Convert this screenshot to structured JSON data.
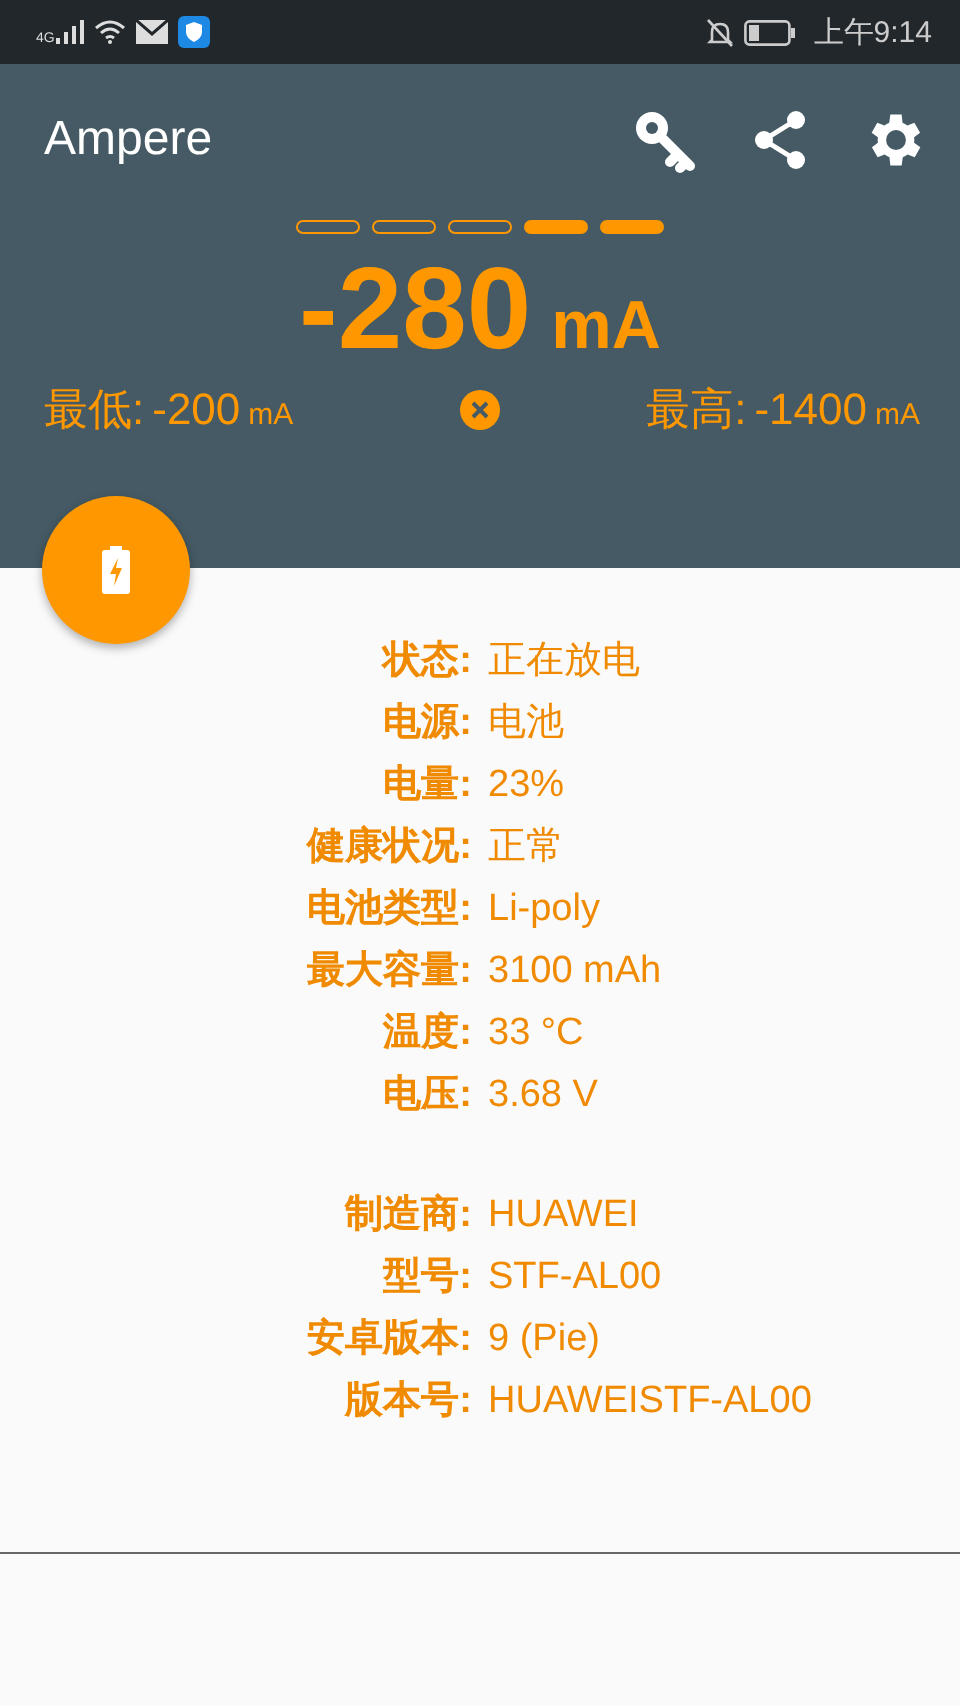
{
  "status_bar": {
    "network": "4G",
    "time": "上午9:14"
  },
  "app_bar": {
    "title": "Ampere"
  },
  "meter": {
    "segments": [
      {
        "filled": false
      },
      {
        "filled": false
      },
      {
        "filled": false
      },
      {
        "filled": true
      },
      {
        "filled": true
      }
    ],
    "value": "-280",
    "unit": "mA",
    "min": {
      "label": "最低:",
      "value": "-200",
      "unit": "mA"
    },
    "max": {
      "label": "最高:",
      "value": "-1400",
      "unit": "mA"
    }
  },
  "sections": [
    {
      "rows": [
        {
          "label": "状态:",
          "value": "正在放电"
        },
        {
          "label": "电源:",
          "value": "电池"
        },
        {
          "label": "电量:",
          "value": "23%"
        },
        {
          "label": "健康状况:",
          "value": "正常"
        },
        {
          "label": "电池类型:",
          "value": "Li-poly"
        },
        {
          "label": "最大容量:",
          "value": "3100 mAh"
        },
        {
          "label": "温度:",
          "value": "33 °C"
        },
        {
          "label": "电压:",
          "value": "3.68 V"
        }
      ]
    },
    {
      "rows": [
        {
          "label": "制造商:",
          "value": "HUAWEI"
        },
        {
          "label": "型号:",
          "value": "STF-AL00"
        },
        {
          "label": "安卓版本:",
          "value": "9 (Pie)"
        },
        {
          "label": "版本号:",
          "value": "HUAWEISTF-AL00"
        }
      ]
    }
  ]
}
